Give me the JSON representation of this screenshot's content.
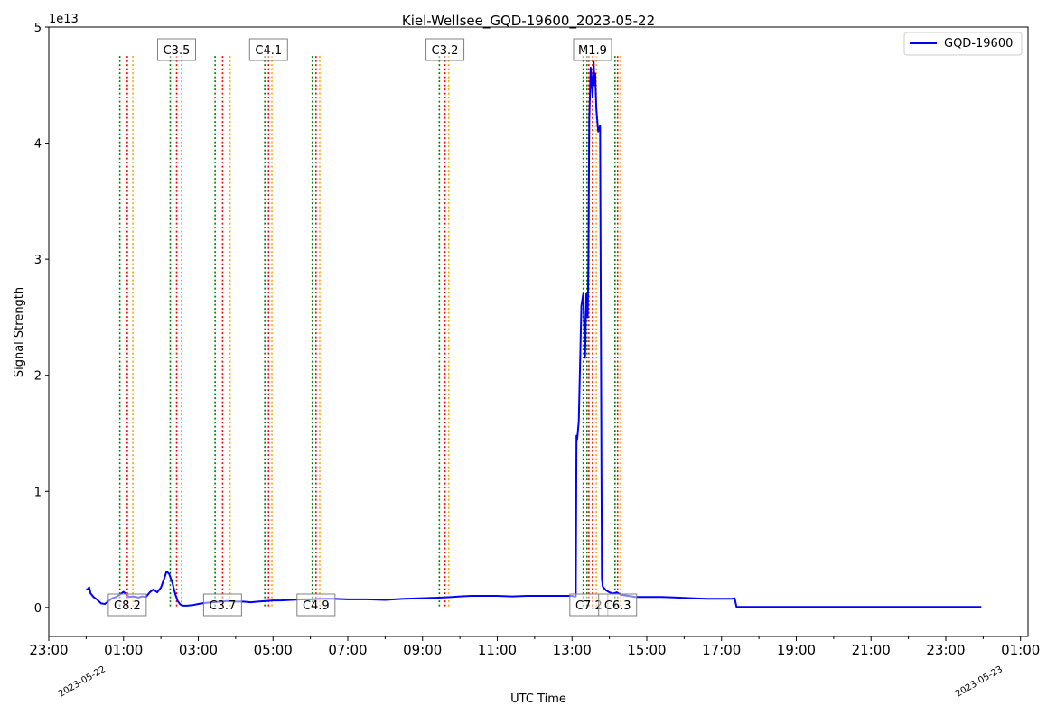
{
  "chart_data": {
    "type": "line",
    "title": "Kiel-Wellsee_GQD-19600_2023-05-22",
    "xlabel": "UTC Time",
    "ylabel": "Signal Strength",
    "y_multiplier_label": "1e13",
    "xlim": [
      -1.0,
      25.2
    ],
    "ylim": [
      -0.25,
      5.0
    ],
    "y_ticks": [
      0,
      1,
      2,
      3,
      4,
      5
    ],
    "y_tick_labels": [
      "0",
      "1",
      "2",
      "3",
      "4",
      "5"
    ],
    "x_ticks": [
      -1,
      1,
      3,
      5,
      7,
      9,
      11,
      13,
      15,
      17,
      19,
      21,
      23,
      25
    ],
    "x_tick_labels": [
      "23:00",
      "01:00",
      "03:00",
      "05:00",
      "07:00",
      "09:00",
      "11:00",
      "13:00",
      "15:00",
      "17:00",
      "19:00",
      "21:00",
      "23:00",
      "01:00"
    ],
    "date_labels": [
      {
        "x": 0,
        "text": "2023-05-22"
      },
      {
        "x": 24,
        "text": "2023-05-23"
      }
    ],
    "grid": false,
    "legend": {
      "position": "top-right",
      "entries": [
        {
          "name": "GQD-19600",
          "color": "#0000ff"
        }
      ]
    },
    "colors": {
      "series": "#0000ff",
      "start": "#008000",
      "peak": "#ff0000",
      "end": "#ffa500"
    },
    "series": [
      {
        "name": "GQD-19600",
        "x": [
          0,
          0.05,
          0.08,
          0.12,
          0.2,
          0.3,
          0.4,
          0.5,
          0.6,
          0.7,
          0.8,
          0.9,
          1.0,
          1.08,
          1.15,
          1.25,
          1.4,
          1.5,
          1.6,
          1.7,
          1.8,
          1.9,
          2.0,
          2.1,
          2.15,
          2.22,
          2.3,
          2.38,
          2.45,
          2.52,
          2.6,
          2.7,
          2.85,
          3.0,
          3.2,
          3.4,
          3.6,
          3.8,
          4.0,
          4.2,
          4.4,
          4.6,
          4.8,
          5.0,
          5.2,
          5.5,
          5.8,
          6.0,
          6.3,
          6.6,
          7.0,
          7.5,
          8.0,
          8.5,
          9.0,
          9.5,
          9.8,
          10.0,
          10.3,
          10.6,
          11.0,
          11.4,
          11.8,
          12.2,
          12.6,
          13.0,
          13.05,
          13.1,
          13.12,
          13.14,
          13.18,
          13.25,
          13.3,
          13.35,
          13.38,
          13.42,
          13.44,
          13.46,
          13.5,
          13.55,
          13.58,
          13.6,
          13.62,
          13.65,
          13.7,
          13.75,
          13.8,
          13.82,
          13.85,
          13.9,
          14.0,
          14.1,
          14.2,
          14.3,
          14.5,
          14.7,
          15.0,
          15.4,
          15.8,
          16.2,
          16.6,
          17.0,
          17.3,
          17.35,
          17.4,
          18,
          19,
          20,
          21,
          22,
          23,
          23.95
        ],
        "values": [
          1.55,
          1.6,
          1.75,
          1.2,
          0.9,
          0.65,
          0.35,
          0.3,
          0.55,
          0.8,
          0.9,
          1.1,
          1.35,
          1.1,
          0.9,
          0.95,
          0.85,
          0.95,
          0.9,
          1.3,
          1.55,
          1.3,
          1.7,
          2.6,
          3.1,
          2.9,
          2.2,
          1.2,
          0.55,
          0.25,
          0.15,
          0.15,
          0.2,
          0.3,
          0.4,
          0.45,
          0.5,
          0.55,
          0.5,
          0.5,
          0.45,
          0.5,
          0.55,
          0.6,
          0.6,
          0.65,
          0.7,
          0.7,
          0.75,
          0.75,
          0.7,
          0.7,
          0.65,
          0.75,
          0.8,
          0.85,
          0.9,
          0.95,
          1.0,
          1.0,
          1.0,
          0.95,
          1.0,
          1.0,
          1.0,
          1.0,
          0.95,
          0.95,
          14.8,
          14.5,
          16.0,
          26.0,
          27.0,
          21.5,
          27.0,
          25.0,
          30.0,
          42.0,
          46.5,
          44.0,
          47.0,
          45.0,
          46.0,
          43.0,
          41.0,
          41.5,
          2.5,
          1.8,
          1.7,
          1.5,
          1.3,
          1.2,
          1.3,
          1.1,
          1.0,
          0.9,
          0.9,
          0.9,
          0.85,
          0.8,
          0.75,
          0.75,
          0.75,
          0.8,
          0.05,
          0.05,
          0.05,
          0.05,
          0.05,
          0.05,
          0.05,
          0.05
        ]
      }
    ],
    "flare_events": [
      {
        "label": "C8.2",
        "label_pos": "bottom",
        "start": 0.9,
        "peak": 1.1,
        "end": 1.25
      },
      {
        "label": "C3.5",
        "label_pos": "top",
        "start": 2.25,
        "peak": 2.42,
        "end": 2.55
      },
      {
        "label": "C3.7",
        "label_pos": "bottom",
        "start": 3.45,
        "peak": 3.65,
        "end": 3.85
      },
      {
        "label": "C4.1",
        "label_pos": "top",
        "start": 4.78,
        "peak": 4.88,
        "end": 4.97
      },
      {
        "label": "C4.9",
        "label_pos": "bottom",
        "start": 6.05,
        "peak": 6.15,
        "end": 6.25
      },
      {
        "label": "C3.2",
        "label_pos": "top",
        "start": 9.45,
        "peak": 9.6,
        "end": 9.7
      },
      {
        "label": "C7.2",
        "label_pos": "bottom",
        "start": 13.3,
        "peak": 13.45,
        "end": 13.55
      },
      {
        "label": "M1.9",
        "label_pos": "top",
        "start": 13.4,
        "peak": 13.55,
        "end": 13.65
      },
      {
        "label": "C6.3",
        "label_pos": "bottom",
        "start": 14.15,
        "peak": 14.22,
        "end": 14.3
      }
    ],
    "flare_line_top": 4.75
  }
}
